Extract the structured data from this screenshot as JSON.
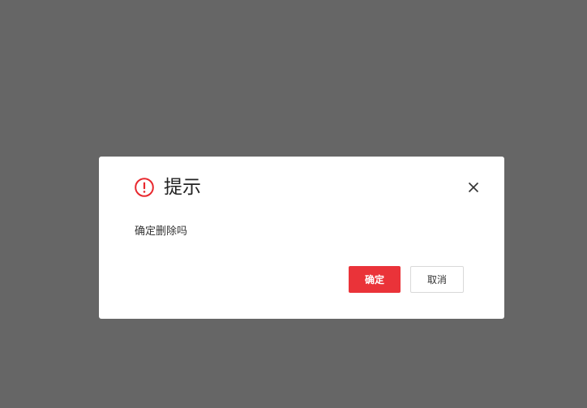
{
  "dialog": {
    "title": "提示",
    "message": "确定删除吗",
    "icon": "warning-circle-icon",
    "confirm_label": "确定",
    "cancel_label": "取消"
  },
  "colors": {
    "overlay": "#666666",
    "accent": "#ea3339",
    "dialog_bg": "#ffffff"
  }
}
